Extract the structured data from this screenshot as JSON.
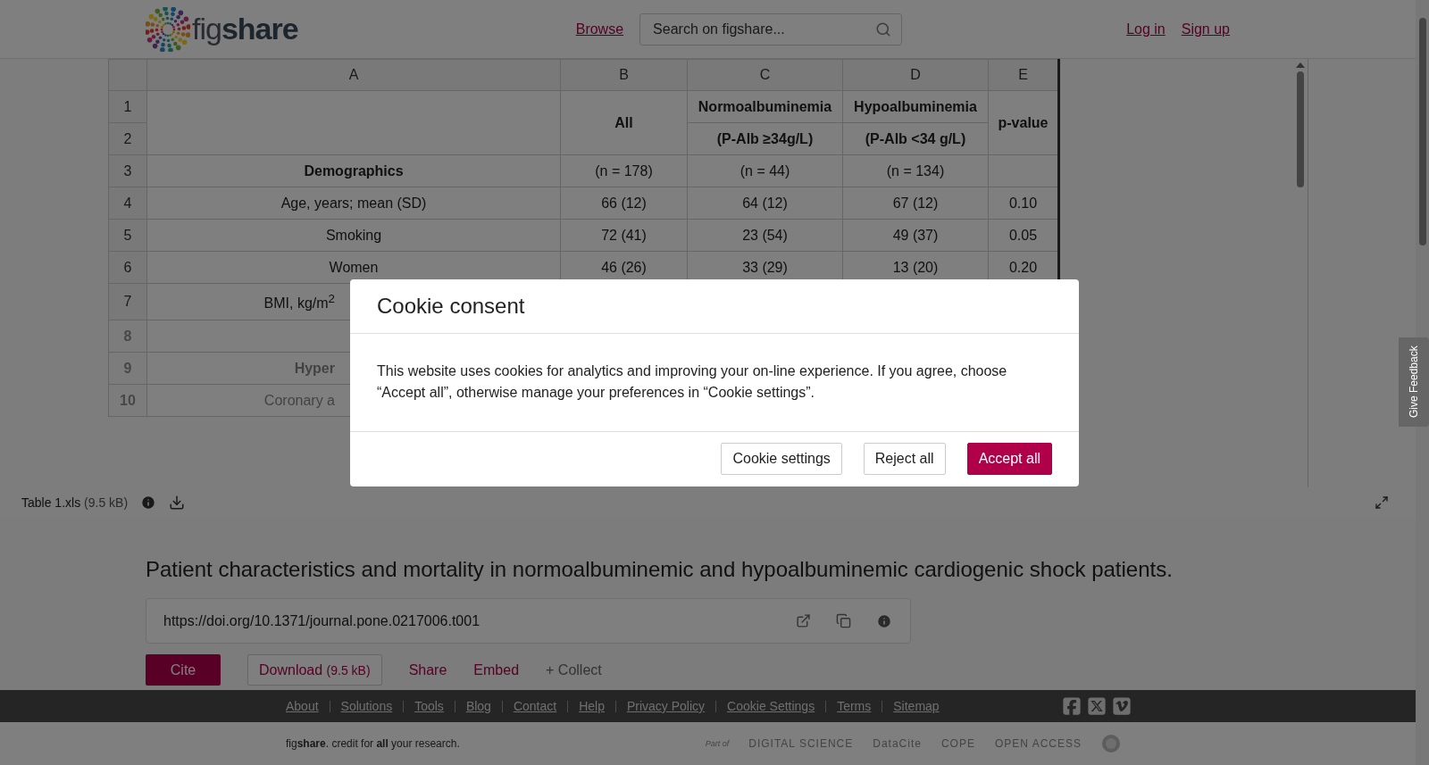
{
  "header": {
    "logo": "fig**share**",
    "nav_link": "Browse",
    "search": {
      "placeholder": "Search on figshare..."
    },
    "auth_links": [
      "Log in",
      "Sign up"
    ]
  },
  "viewer": {
    "columns": [
      "A",
      "B",
      "C",
      "D",
      "E"
    ],
    "rows": [
      {
        "number": "1",
        "cells": [
          {
            "text": "",
            "kind": "value",
            "rowspan": 2
          },
          {
            "text": "All",
            "kind": "heading",
            "rowspan": 2
          },
          {
            "text": "Normoalbuminemia",
            "kind": "heading"
          },
          {
            "text": "Hypoalbuminemia",
            "kind": "heading"
          },
          {
            "text": "p-value",
            "kind": "heading",
            "rowspan": 2
          }
        ]
      },
      {
        "number": "2",
        "cells": [
          {
            "text": "(P-Alb ≥34g/L)",
            "kind": "heading"
          },
          {
            "text": "(P-Alb <34 g/L)",
            "kind": "heading"
          }
        ]
      },
      {
        "number": "3",
        "cells": [
          {
            "text": "Demographics",
            "kind": "heading"
          },
          {
            "text": "(n = 178)",
            "kind": "value"
          },
          {
            "text": "(n = 44)",
            "kind": "value"
          },
          {
            "text": "(n = 134)",
            "kind": "value"
          },
          {
            "text": "",
            "kind": "value"
          }
        ]
      },
      {
        "number": "4",
        "cells": [
          {
            "text": "Age, years; mean (SD)",
            "kind": "value"
          },
          {
            "text": "66 (12)",
            "kind": "value"
          },
          {
            "text": "64 (12)",
            "kind": "value"
          },
          {
            "text": "67 (12)",
            "kind": "value"
          },
          {
            "text": "0.10",
            "kind": "value"
          }
        ]
      },
      {
        "number": "5",
        "cells": [
          {
            "text": "Smoking",
            "kind": "value"
          },
          {
            "text": "72 (41)",
            "kind": "value"
          },
          {
            "text": "23 (54)",
            "kind": "value"
          },
          {
            "text": "49 (37)",
            "kind": "value"
          },
          {
            "text": "0.05",
            "kind": "value"
          }
        ]
      },
      {
        "number": "6",
        "cells": [
          {
            "text": "Women",
            "kind": "value"
          },
          {
            "text": "46 (26)",
            "kind": "value"
          },
          {
            "text": "33 (29)",
            "kind": "value"
          },
          {
            "text": "13 (20)",
            "kind": "value"
          },
          {
            "text": "0.20",
            "kind": "value"
          }
        ]
      },
      {
        "number": "7",
        "tall": true,
        "cells": [
          {
            "text": "BMI, kg/m$^{2}$",
            "kind": "clipped"
          }
        ]
      },
      {
        "number": "8",
        "faded": true,
        "cells": [
          {
            "text": "",
            "kind": "value"
          }
        ]
      },
      {
        "number": "9",
        "faded": true,
        "cells": [
          {
            "text": "Hyper",
            "kind": "clipped_heading"
          }
        ]
      },
      {
        "number": "10",
        "faded": true,
        "cells": [
          {
            "text": "Coronary a",
            "kind": "clipped"
          }
        ]
      }
    ],
    "file_name": "Table 1.xls",
    "file_size": "(9.5 kB)"
  },
  "item": {
    "title": "Patient characteristics and mortality in normoalbuminemic and hypoalbuminemic cardiogenic shock patients.",
    "doi": "https://doi.org/10.1371/journal.pone.0217006.t001",
    "actions": [
      {
        "label": "Cite",
        "kind": "primary"
      },
      {
        "label": "Download",
        "extra": "(9.5 kB)",
        "kind": "outline"
      },
      {
        "label": "Share",
        "kind": "link"
      },
      {
        "label": "Embed",
        "kind": "link"
      },
      {
        "label": "+ Collect",
        "kind": "muted"
      }
    ]
  },
  "footer": {
    "links": [
      "About",
      "Solutions",
      "Tools",
      "Blog",
      "Contact",
      "Help",
      "Privacy Policy",
      "Cookie Settings",
      "Terms",
      "Sitemap"
    ],
    "tagline": "fig**share**. credit for **all** your research.",
    "partners": [
      "Part of",
      "DIGITAL SCIENCE",
      "DataCite",
      "COPE",
      "OPEN ACCESS"
    ]
  },
  "feedback_tab": "Give Feedback",
  "cookie_dialog": {
    "title": "Cookie consent",
    "message": "This website uses cookies for analytics and improving your on-line experience. If you agree, choose “Accept all”, otherwise manage your preferences in “Cookie settings”.",
    "buttons": [
      {
        "label": "Cookie settings",
        "kind": "secondary"
      },
      {
        "label": "Reject all",
        "kind": "secondary"
      },
      {
        "label": "Accept all",
        "kind": "primary"
      }
    ]
  }
}
